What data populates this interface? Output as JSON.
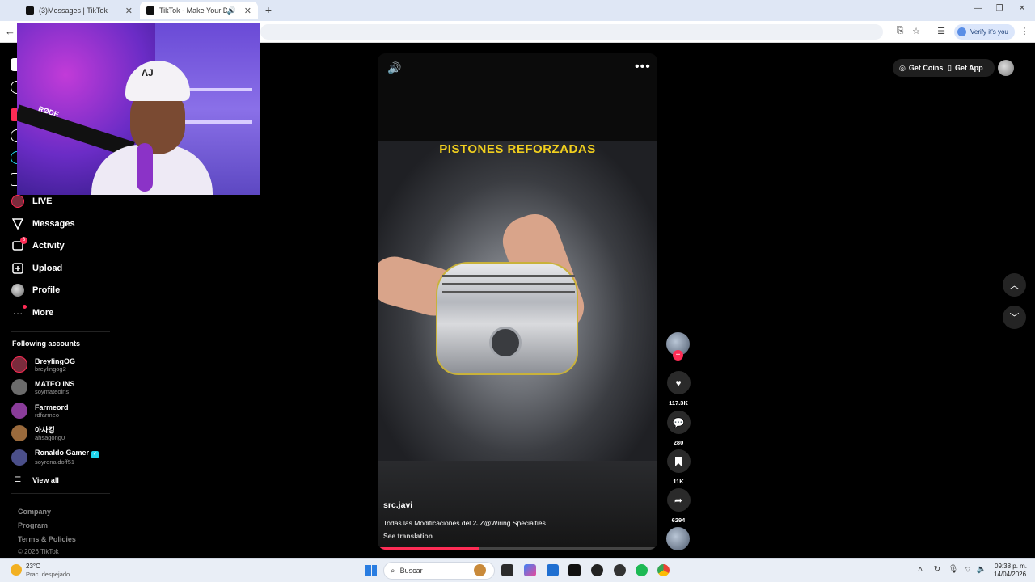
{
  "browser": {
    "tabs": [
      {
        "title": "(3)Messages | TikTok",
        "close": "✕"
      },
      {
        "title": "TikTok - Make Your Day",
        "close": "✕"
      }
    ],
    "new_tab": "+",
    "verify_label": "Verify it's you"
  },
  "sidebar": {
    "items": [
      {
        "label": "LIVE"
      },
      {
        "label": "Messages"
      },
      {
        "label": "Activity",
        "badge": "3"
      },
      {
        "label": "Upload"
      },
      {
        "label": "Profile"
      },
      {
        "label": "More"
      }
    ],
    "following_title": "Following accounts",
    "accounts": [
      {
        "name": "BreylingOG",
        "handle": "breylingog2",
        "color": "#7a2b3c"
      },
      {
        "name": "MATEO INS",
        "handle": "soymateoins",
        "color": "#6c6c6c"
      },
      {
        "name": "Farmeord",
        "handle": "rdfarmeo",
        "color": "#8a3c9a"
      },
      {
        "name": "아사킹",
        "handle": "ahsagong0",
        "color": "#9a6a3c"
      },
      {
        "name": "Ronaldo Gamer",
        "handle": "soyronaldoff51",
        "color": "#4b4f8a",
        "verified": true
      }
    ],
    "view_all": "View all",
    "footer": [
      "Company",
      "Program",
      "Terms & Policies"
    ],
    "copyright": "© 2026 TikTok"
  },
  "topbar": {
    "get_coins": "Get Coins",
    "get_app": "Get App"
  },
  "video": {
    "overlay_title": "PISTONES REFORZADAS",
    "author": "src.javi",
    "caption": "Todas las Modificaciones del 2JZ@Wiring Specialties",
    "see_translation": "See translation",
    "progress": 0.36
  },
  "actions": {
    "likes": "117.3K",
    "comments": "280",
    "saves": "11K",
    "shares": "6294"
  },
  "webcam": {
    "mic_brand": "RØDE",
    "cap_logo": "ΛJ"
  },
  "taskbar": {
    "temp": "23°C",
    "weather": "Prac. despejado",
    "search_placeholder": "Buscar",
    "time": "09:38 p. m.",
    "date": "14/04/2026"
  },
  "colors": {
    "accent": "#fe2c55",
    "title_yellow": "#f1cf1e",
    "verified": "#20d5ec"
  }
}
